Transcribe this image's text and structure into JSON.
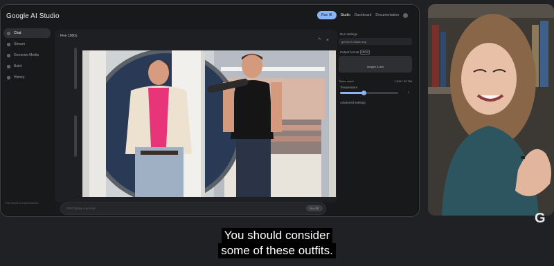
{
  "app": {
    "title": "Google AI Studio"
  },
  "header": {
    "run_button": "Run ⌘",
    "tabs": [
      "Studio",
      "Dashboard",
      "Documentation"
    ]
  },
  "sidebar": {
    "items": [
      {
        "label": "Chat",
        "active": true
      },
      {
        "label": "Stream"
      },
      {
        "label": "Generate Media"
      },
      {
        "label": "Build"
      },
      {
        "label": "History"
      }
    ],
    "footer": "This model is experimental..."
  },
  "panel": {
    "title": "Five 1980s"
  },
  "prompt": {
    "placeholder": "Start typing a prompt",
    "run_label": "Run ⌘"
  },
  "settings": {
    "section_label": "Run settings",
    "model_value": "gemini-2.0-flash-exp",
    "output_format_label": "Output format",
    "output_format_badge": "NEW",
    "images_text_button": "Images & text",
    "token_count_label": "Token count",
    "token_count_value": "1,516 / 32,768",
    "temperature_label": "Temperature",
    "temperature_value": "1",
    "temperature_fraction": 0.4,
    "advanced_label": "Advanced settings"
  },
  "viewer": {
    "subject": "two-outfit-comparison-photo"
  },
  "meeting": {
    "brand_logo": "G"
  },
  "caption": {
    "line1": "You should consider",
    "line2": "some of these outfits."
  },
  "colors": {
    "accent": "#8ab4f8",
    "bg": "#202124",
    "caption_bg": "#000000"
  }
}
